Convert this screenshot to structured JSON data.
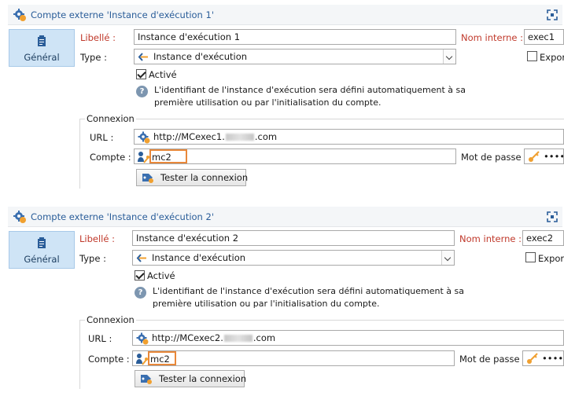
{
  "panels": [
    {
      "title": "Compte externe 'Instance d'exécution 1'",
      "tab_label": "Général",
      "libelle_label": "Libellé :",
      "libelle_value": "Instance d'exécution 1",
      "nom_interne_label": "Nom interne :",
      "nom_interne_value": "exec1",
      "type_label": "Type :",
      "type_value": "Instance d'exécution",
      "export_label": "Export",
      "active_label": "Activé",
      "info_text": "L'identifiant de l'instance d'exécution sera défini automatiquement à sa première utilisation ou par l'initialisation du compte.",
      "connexion_legend": "Connexion",
      "url_label": "URL :",
      "url_prefix": "http://MCexec1.",
      "url_suffix": ".com",
      "compte_label": "Compte :",
      "compte_value": "mc2",
      "password_label": "Mot de passe :",
      "password_value": "••••",
      "test_button": "Tester la connexion"
    },
    {
      "title": "Compte externe 'Instance d'exécution 2'",
      "tab_label": "Général",
      "libelle_label": "Libellé :",
      "libelle_value": "Instance d'exécution 2",
      "nom_interne_label": "Nom interne :",
      "nom_interne_value": "exec2",
      "type_label": "Type :",
      "type_value": "Instance d'exécution",
      "export_label": "Export",
      "active_label": "Activé",
      "info_text": "L'identifiant de l'instance d'exécution sera défini automatiquement à sa première utilisation ou par l'initialisation du compte.",
      "connexion_legend": "Connexion",
      "url_label": "URL :",
      "url_prefix": "http://MCexec2.",
      "url_suffix": ".com",
      "compte_label": "Compte :",
      "compte_value": "mc2",
      "password_label": "Mot de passe :",
      "password_value": "••••",
      "test_button": "Tester la connexion"
    }
  ],
  "icons": {
    "title": "gear-account-icon",
    "expand": "expand-icon",
    "tab": "clipboard-icon",
    "type": "arrow-left-icon",
    "help": "question-icon",
    "url": "gear-link-icon",
    "account": "user-key-icon",
    "password": "key-icon",
    "test": "tag-test-icon"
  },
  "colors": {
    "title_text": "#2a5d99",
    "required_label": "#c0392b",
    "tab_background": "#cfe4f6",
    "highlight_border": "#e8883a"
  }
}
